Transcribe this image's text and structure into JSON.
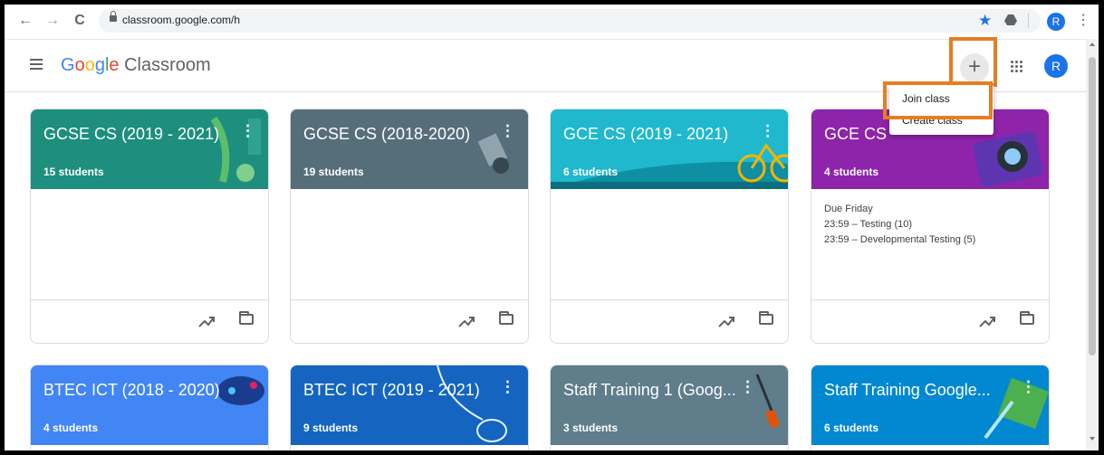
{
  "browser": {
    "url": "classroom.google.com/h",
    "profile_initial": "R",
    "back_icon": "←",
    "forward_icon": "→",
    "reload_icon": "C",
    "star_icon": "★",
    "menu_icon": "⋮"
  },
  "header": {
    "logo_google": [
      "G",
      "o",
      "o",
      "g",
      "l",
      "e"
    ],
    "logo_product": "Classroom",
    "plus_label": "+",
    "avatar_initial": "R"
  },
  "menu": {
    "items": [
      {
        "label": "Join class"
      },
      {
        "label": "Create class"
      }
    ]
  },
  "classes": [
    {
      "title": "GCSE CS (2019 - 2021)",
      "students": "15 students",
      "color": "#1e8e7e"
    },
    {
      "title": "GCSE CS (2018-2020)",
      "students": "19 students",
      "color": "#566e7a"
    },
    {
      "title": "GCE CS (2019 - 2021)",
      "students": "6 students",
      "color": "#1fb8cd"
    },
    {
      "title": "GCE CS",
      "students": "4 students",
      "color": "#8e24aa",
      "due": {
        "heading": "Due Friday",
        "items": [
          "23:59 – Testing (10)",
          "23:59 – Developmental Testing (5)"
        ]
      }
    },
    {
      "title": "BTEC ICT (2018 - 2020)",
      "students": "4 students",
      "color": "#4285f4"
    },
    {
      "title": "BTEC ICT (2019 - 2021)",
      "students": "9 students",
      "color": "#1565c0"
    },
    {
      "title": "Staff Training 1 (Goog...",
      "students": "3 students",
      "color": "#607d8b"
    },
    {
      "title": "Staff Training Google...",
      "students": "6 students",
      "color": "#0288d1"
    }
  ],
  "kebab_icon": "⋮"
}
